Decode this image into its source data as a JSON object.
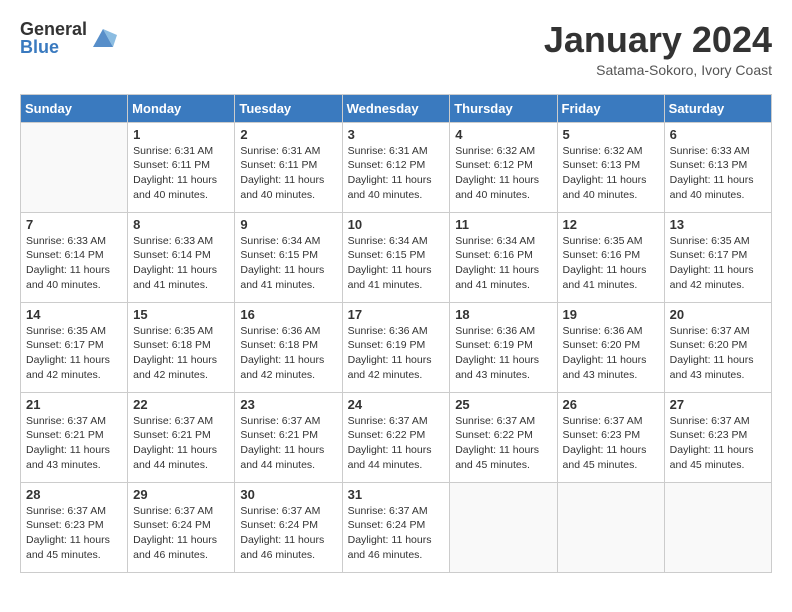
{
  "logo": {
    "general": "General",
    "blue": "Blue"
  },
  "title": "January 2024",
  "subtitle": "Satama-Sokoro, Ivory Coast",
  "days_of_week": [
    "Sunday",
    "Monday",
    "Tuesday",
    "Wednesday",
    "Thursday",
    "Friday",
    "Saturday"
  ],
  "weeks": [
    [
      {
        "day": "",
        "sunrise": "",
        "sunset": "",
        "daylight": ""
      },
      {
        "day": "1",
        "sunrise": "Sunrise: 6:31 AM",
        "sunset": "Sunset: 6:11 PM",
        "daylight": "Daylight: 11 hours and 40 minutes."
      },
      {
        "day": "2",
        "sunrise": "Sunrise: 6:31 AM",
        "sunset": "Sunset: 6:11 PM",
        "daylight": "Daylight: 11 hours and 40 minutes."
      },
      {
        "day": "3",
        "sunrise": "Sunrise: 6:31 AM",
        "sunset": "Sunset: 6:12 PM",
        "daylight": "Daylight: 11 hours and 40 minutes."
      },
      {
        "day": "4",
        "sunrise": "Sunrise: 6:32 AM",
        "sunset": "Sunset: 6:12 PM",
        "daylight": "Daylight: 11 hours and 40 minutes."
      },
      {
        "day": "5",
        "sunrise": "Sunrise: 6:32 AM",
        "sunset": "Sunset: 6:13 PM",
        "daylight": "Daylight: 11 hours and 40 minutes."
      },
      {
        "day": "6",
        "sunrise": "Sunrise: 6:33 AM",
        "sunset": "Sunset: 6:13 PM",
        "daylight": "Daylight: 11 hours and 40 minutes."
      }
    ],
    [
      {
        "day": "7",
        "sunrise": "Sunrise: 6:33 AM",
        "sunset": "Sunset: 6:14 PM",
        "daylight": "Daylight: 11 hours and 40 minutes."
      },
      {
        "day": "8",
        "sunrise": "Sunrise: 6:33 AM",
        "sunset": "Sunset: 6:14 PM",
        "daylight": "Daylight: 11 hours and 41 minutes."
      },
      {
        "day": "9",
        "sunrise": "Sunrise: 6:34 AM",
        "sunset": "Sunset: 6:15 PM",
        "daylight": "Daylight: 11 hours and 41 minutes."
      },
      {
        "day": "10",
        "sunrise": "Sunrise: 6:34 AM",
        "sunset": "Sunset: 6:15 PM",
        "daylight": "Daylight: 11 hours and 41 minutes."
      },
      {
        "day": "11",
        "sunrise": "Sunrise: 6:34 AM",
        "sunset": "Sunset: 6:16 PM",
        "daylight": "Daylight: 11 hours and 41 minutes."
      },
      {
        "day": "12",
        "sunrise": "Sunrise: 6:35 AM",
        "sunset": "Sunset: 6:16 PM",
        "daylight": "Daylight: 11 hours and 41 minutes."
      },
      {
        "day": "13",
        "sunrise": "Sunrise: 6:35 AM",
        "sunset": "Sunset: 6:17 PM",
        "daylight": "Daylight: 11 hours and 42 minutes."
      }
    ],
    [
      {
        "day": "14",
        "sunrise": "Sunrise: 6:35 AM",
        "sunset": "Sunset: 6:17 PM",
        "daylight": "Daylight: 11 hours and 42 minutes."
      },
      {
        "day": "15",
        "sunrise": "Sunrise: 6:35 AM",
        "sunset": "Sunset: 6:18 PM",
        "daylight": "Daylight: 11 hours and 42 minutes."
      },
      {
        "day": "16",
        "sunrise": "Sunrise: 6:36 AM",
        "sunset": "Sunset: 6:18 PM",
        "daylight": "Daylight: 11 hours and 42 minutes."
      },
      {
        "day": "17",
        "sunrise": "Sunrise: 6:36 AM",
        "sunset": "Sunset: 6:19 PM",
        "daylight": "Daylight: 11 hours and 42 minutes."
      },
      {
        "day": "18",
        "sunrise": "Sunrise: 6:36 AM",
        "sunset": "Sunset: 6:19 PM",
        "daylight": "Daylight: 11 hours and 43 minutes."
      },
      {
        "day": "19",
        "sunrise": "Sunrise: 6:36 AM",
        "sunset": "Sunset: 6:20 PM",
        "daylight": "Daylight: 11 hours and 43 minutes."
      },
      {
        "day": "20",
        "sunrise": "Sunrise: 6:37 AM",
        "sunset": "Sunset: 6:20 PM",
        "daylight": "Daylight: 11 hours and 43 minutes."
      }
    ],
    [
      {
        "day": "21",
        "sunrise": "Sunrise: 6:37 AM",
        "sunset": "Sunset: 6:21 PM",
        "daylight": "Daylight: 11 hours and 43 minutes."
      },
      {
        "day": "22",
        "sunrise": "Sunrise: 6:37 AM",
        "sunset": "Sunset: 6:21 PM",
        "daylight": "Daylight: 11 hours and 44 minutes."
      },
      {
        "day": "23",
        "sunrise": "Sunrise: 6:37 AM",
        "sunset": "Sunset: 6:21 PM",
        "daylight": "Daylight: 11 hours and 44 minutes."
      },
      {
        "day": "24",
        "sunrise": "Sunrise: 6:37 AM",
        "sunset": "Sunset: 6:22 PM",
        "daylight": "Daylight: 11 hours and 44 minutes."
      },
      {
        "day": "25",
        "sunrise": "Sunrise: 6:37 AM",
        "sunset": "Sunset: 6:22 PM",
        "daylight": "Daylight: 11 hours and 45 minutes."
      },
      {
        "day": "26",
        "sunrise": "Sunrise: 6:37 AM",
        "sunset": "Sunset: 6:23 PM",
        "daylight": "Daylight: 11 hours and 45 minutes."
      },
      {
        "day": "27",
        "sunrise": "Sunrise: 6:37 AM",
        "sunset": "Sunset: 6:23 PM",
        "daylight": "Daylight: 11 hours and 45 minutes."
      }
    ],
    [
      {
        "day": "28",
        "sunrise": "Sunrise: 6:37 AM",
        "sunset": "Sunset: 6:23 PM",
        "daylight": "Daylight: 11 hours and 45 minutes."
      },
      {
        "day": "29",
        "sunrise": "Sunrise: 6:37 AM",
        "sunset": "Sunset: 6:24 PM",
        "daylight": "Daylight: 11 hours and 46 minutes."
      },
      {
        "day": "30",
        "sunrise": "Sunrise: 6:37 AM",
        "sunset": "Sunset: 6:24 PM",
        "daylight": "Daylight: 11 hours and 46 minutes."
      },
      {
        "day": "31",
        "sunrise": "Sunrise: 6:37 AM",
        "sunset": "Sunset: 6:24 PM",
        "daylight": "Daylight: 11 hours and 46 minutes."
      },
      {
        "day": "",
        "sunrise": "",
        "sunset": "",
        "daylight": ""
      },
      {
        "day": "",
        "sunrise": "",
        "sunset": "",
        "daylight": ""
      },
      {
        "day": "",
        "sunrise": "",
        "sunset": "",
        "daylight": ""
      }
    ]
  ]
}
